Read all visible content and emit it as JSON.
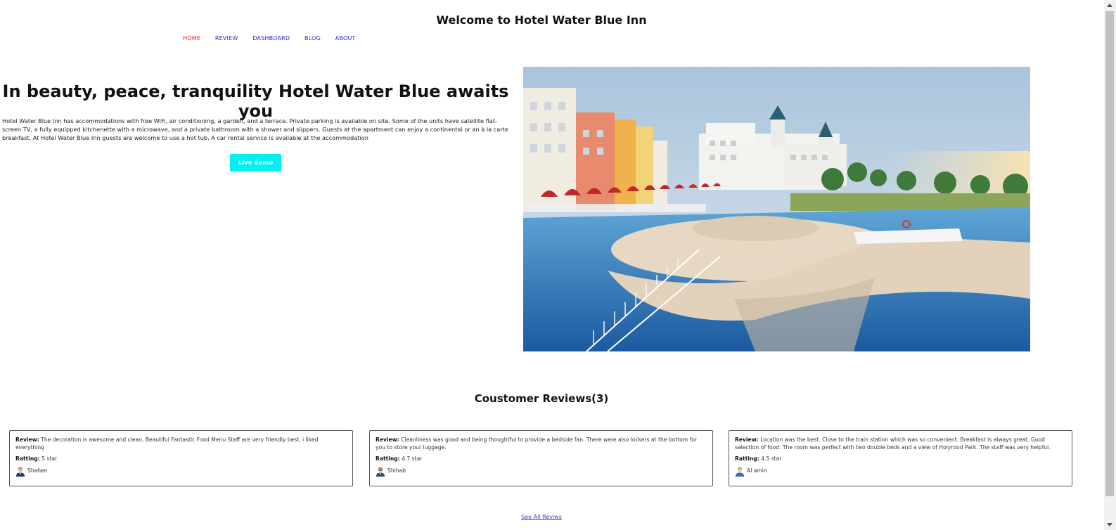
{
  "header": {
    "title": "Welcome to Hotel Water Blue Inn"
  },
  "nav": {
    "items": [
      "HOME",
      "REVIEW",
      "DASHBOARD",
      "BLOG",
      "ABOUT"
    ],
    "active": "HOME"
  },
  "hero": {
    "heading": "In beauty, peace, tranquility Hotel Water Blue awaits you",
    "text": "Hotel Water Blue Inn has accommodations with free WiFi, air conditioning, a garden, and a terrace. Private parking is available on site. Some of the units have satellite flat-screen TV, a fully equipped kitchenette with a microwave, and a private bathroom with a shower and slippers. Guests at the apartment can enjoy a continental or an à la carte breakfast. At Hotel Water Blue Inn guests are welcome to use a hot tub. A car rental service is available at the accommodation",
    "button_label": "Live demo",
    "button_color": "#00f0f0"
  },
  "reviews": {
    "heading": "Coustomer Reviews(3)",
    "review_label": "Review:",
    "rating_label": "Ratting:",
    "items": [
      {
        "review": "The decoration is awesome and clean, Beautiful Fantastic Food Menu Staff are very friendly best, i liked everything",
        "rating": "5 star",
        "name": "Shahen"
      },
      {
        "review": "Cleanliness was good and being thoughtful to provide a bedside fan. There were also lockers at the bottom for you to store your luggage.",
        "rating": "4.7 star",
        "name": "Shihab"
      },
      {
        "review": "Location was the best. Close to the train station which was so convenient. Breakfast is always great. Good selection of food. The room was perfect with two double beds and a view of Holyrood Park. The staff was very helpful.",
        "rating": "4.5 star",
        "name": "Al amin"
      }
    ],
    "see_all": "See All Reviws"
  },
  "colors": {
    "nav_link": "#2323d6",
    "nav_active": "#e21b1b",
    "see_all_link": "#5a2ab0"
  }
}
